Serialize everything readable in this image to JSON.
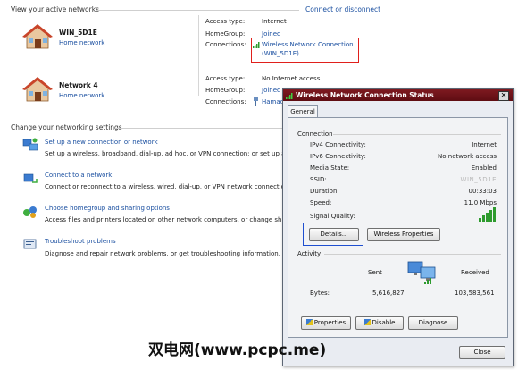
{
  "active_networks": {
    "heading": "View your active networks",
    "connect_link": "Connect or disconnect",
    "networks": [
      {
        "name": "WIN_5D1E",
        "type": "Home network",
        "access_type_label": "Access type:",
        "access_type_value": "Internet",
        "homegroup_label": "HomeGroup:",
        "homegroup_value": "Joined",
        "connections_label": "Connections:",
        "connection_value_line1": "Wireless Network Connection",
        "connection_value_line2": "(WIN_5D1E)"
      },
      {
        "name": "Network  4",
        "type": "Home network",
        "access_type_label": "Access type:",
        "access_type_value": "No Internet access",
        "homegroup_label": "HomeGroup:",
        "homegroup_value": "Joined",
        "connections_label": "Connections:",
        "connection_value_line1": "Hamac"
      }
    ]
  },
  "settings": {
    "heading": "Change your networking settings",
    "tasks": [
      {
        "title": "Set up a new connection or network",
        "desc": "Set up a wireless, broadband, dial-up, ad hoc, or VPN connection; or set up a r"
      },
      {
        "title": "Connect to a network",
        "desc": "Connect or reconnect to a wireless, wired, dial-up, or VPN network connectio"
      },
      {
        "title": "Choose homegroup and sharing options",
        "desc": "Access files and printers located on other network computers, or change shar"
      },
      {
        "title": "Troubleshoot problems",
        "desc": "Diagnose and repair network problems, or get troubleshooting information."
      }
    ]
  },
  "dialog": {
    "title": "Wireless Network Connection Status",
    "close_glyph": "✕",
    "tab": "General",
    "connection_heading": "Connection",
    "rows": [
      {
        "label": "IPv4 Connectivity:",
        "value": "Internet"
      },
      {
        "label": "IPv6 Connectivity:",
        "value": "No network access"
      },
      {
        "label": "Media State:",
        "value": "Enabled"
      },
      {
        "label": "SSID:",
        "value": "WIN_5D1E"
      },
      {
        "label": "Duration:",
        "value": "00:33:03"
      },
      {
        "label": "Speed:",
        "value": "11.0 Mbps"
      }
    ],
    "signal_quality_label": "Signal Quality:",
    "details_button": "Details...",
    "wireless_properties_button": "Wireless Properties",
    "activity_heading": "Activity",
    "sent_label": "Sent",
    "received_label": "Received",
    "bytes_label": "Bytes:",
    "bytes_sent": "5,616,827",
    "bytes_received": "103,583,561",
    "properties_button": "Properties",
    "disable_button": "Disable",
    "diagnose_button": "Diagnose",
    "close_button": "Close"
  },
  "watermark": "双电网(www.pcpc.me)",
  "colors": {
    "link": "#1a4fa0",
    "title_bar": "#6e131a",
    "highlight_red": "#e0201c",
    "highlight_blue": "#1f4fd0",
    "signal_green": "#2e9b2e"
  },
  "icons": [
    "house-icon",
    "signal-bars-icon",
    "network-setup-icon",
    "connect-network-icon",
    "homegroup-icon",
    "troubleshoot-icon",
    "computers-activity-icon"
  ]
}
